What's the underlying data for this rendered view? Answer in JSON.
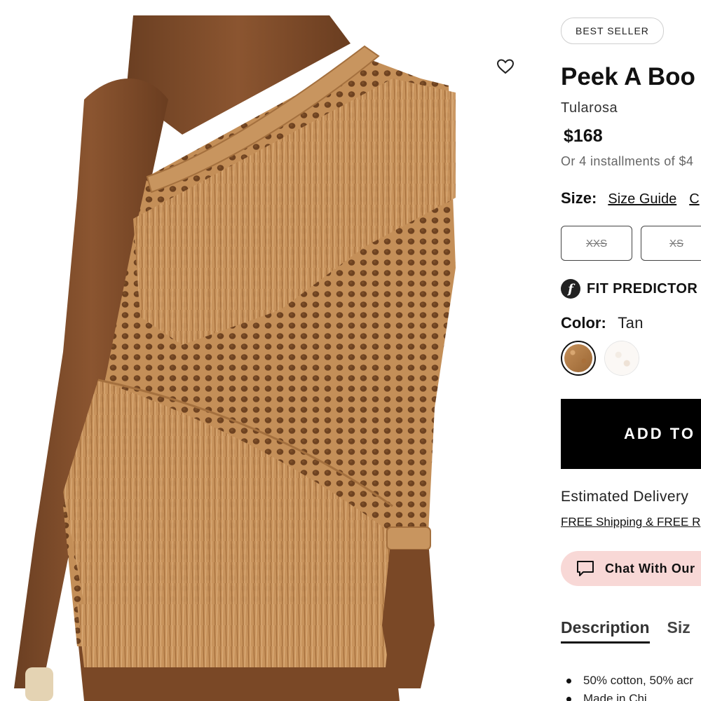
{
  "badge": "BEST SELLER",
  "product": {
    "title": "Peek A Boo",
    "brand": "Tularosa",
    "price": "$168",
    "installments": "Or 4 installments of $4"
  },
  "size": {
    "label": "Size:",
    "guide_link": "Size Guide",
    "other_link": "C",
    "options": [
      {
        "label": "XXS",
        "available": false
      },
      {
        "label": "XS",
        "available": false
      }
    ]
  },
  "fit_predictor": {
    "icon": "fit-predictor-logo-icon",
    "label": "FIT PREDICTOR"
  },
  "color": {
    "label": "Color:",
    "value": "Tan",
    "swatches": [
      {
        "name": "Tan",
        "hex": "#b07a44",
        "selected": true
      },
      {
        "name": "White",
        "hex": "#f7f3ef",
        "selected": false
      }
    ]
  },
  "add_to_bag": "ADD TO",
  "delivery": {
    "estimated": "Estimated Delivery",
    "shipping_link": "FREE Shipping & FREE R"
  },
  "chat": {
    "icon": "chat-bubble-icon",
    "label": "Chat With Our"
  },
  "tabs": [
    {
      "label": "Description",
      "active": true
    },
    {
      "label": "Siz",
      "active": false
    }
  ],
  "description": {
    "items": [
      "50% cotton, 50% acr",
      "Made in Chi"
    ]
  },
  "colors": {
    "add_button_bg": "#000000",
    "chat_bg": "#f8d8d6",
    "dress_tan": "#c4915a"
  }
}
